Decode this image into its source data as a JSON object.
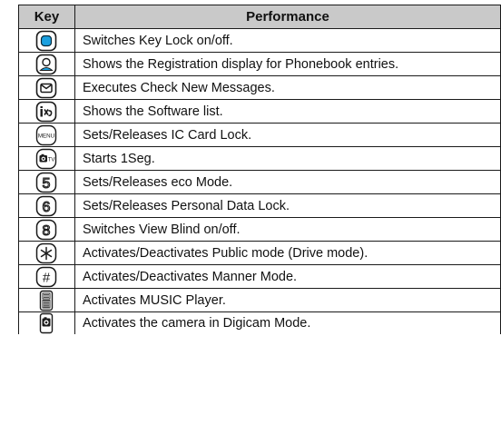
{
  "table": {
    "headers": {
      "key": "Key",
      "performance": "Performance"
    },
    "rows": [
      {
        "icon": "clear-key-icon",
        "performance": "Switches Key Lock on/off."
      },
      {
        "icon": "phonebook-key-icon",
        "performance": "Shows the Registration display for Phonebook entries."
      },
      {
        "icon": "mail-key-icon",
        "performance": "Executes Check New Messages."
      },
      {
        "icon": "i-appli-key-icon",
        "performance": "Shows the Software list."
      },
      {
        "icon": "menu-key-icon",
        "performance": "Sets/Releases IC Card Lock."
      },
      {
        "icon": "camera-tv-key-icon",
        "performance": "Starts 1Seg."
      },
      {
        "icon": "five-key-icon",
        "label": "5",
        "performance": "Sets/Releases eco Mode."
      },
      {
        "icon": "six-key-icon",
        "label": "6",
        "performance": "Sets/Releases Personal Data Lock."
      },
      {
        "icon": "eight-key-icon",
        "label": "8",
        "performance": "Switches View Blind on/off."
      },
      {
        "icon": "asterisk-key-icon",
        "performance": "Activates/Deactivates Public mode (Drive mode)."
      },
      {
        "icon": "pound-key-icon",
        "label": "#",
        "performance": "Activates/Deactivates Manner Mode."
      },
      {
        "icon": "music-side-key-icon",
        "performance": "Activates MUSIC Player."
      },
      {
        "icon": "camera-side-key-icon",
        "performance": "Activates the camera in Digicam Mode."
      }
    ]
  },
  "key_labels": {
    "menu": "MENU",
    "tv": "TV"
  },
  "colors": {
    "header_bg": "#c9c9c9",
    "border": "#1a1a1a",
    "accent_blue": "#1aa0e0"
  }
}
